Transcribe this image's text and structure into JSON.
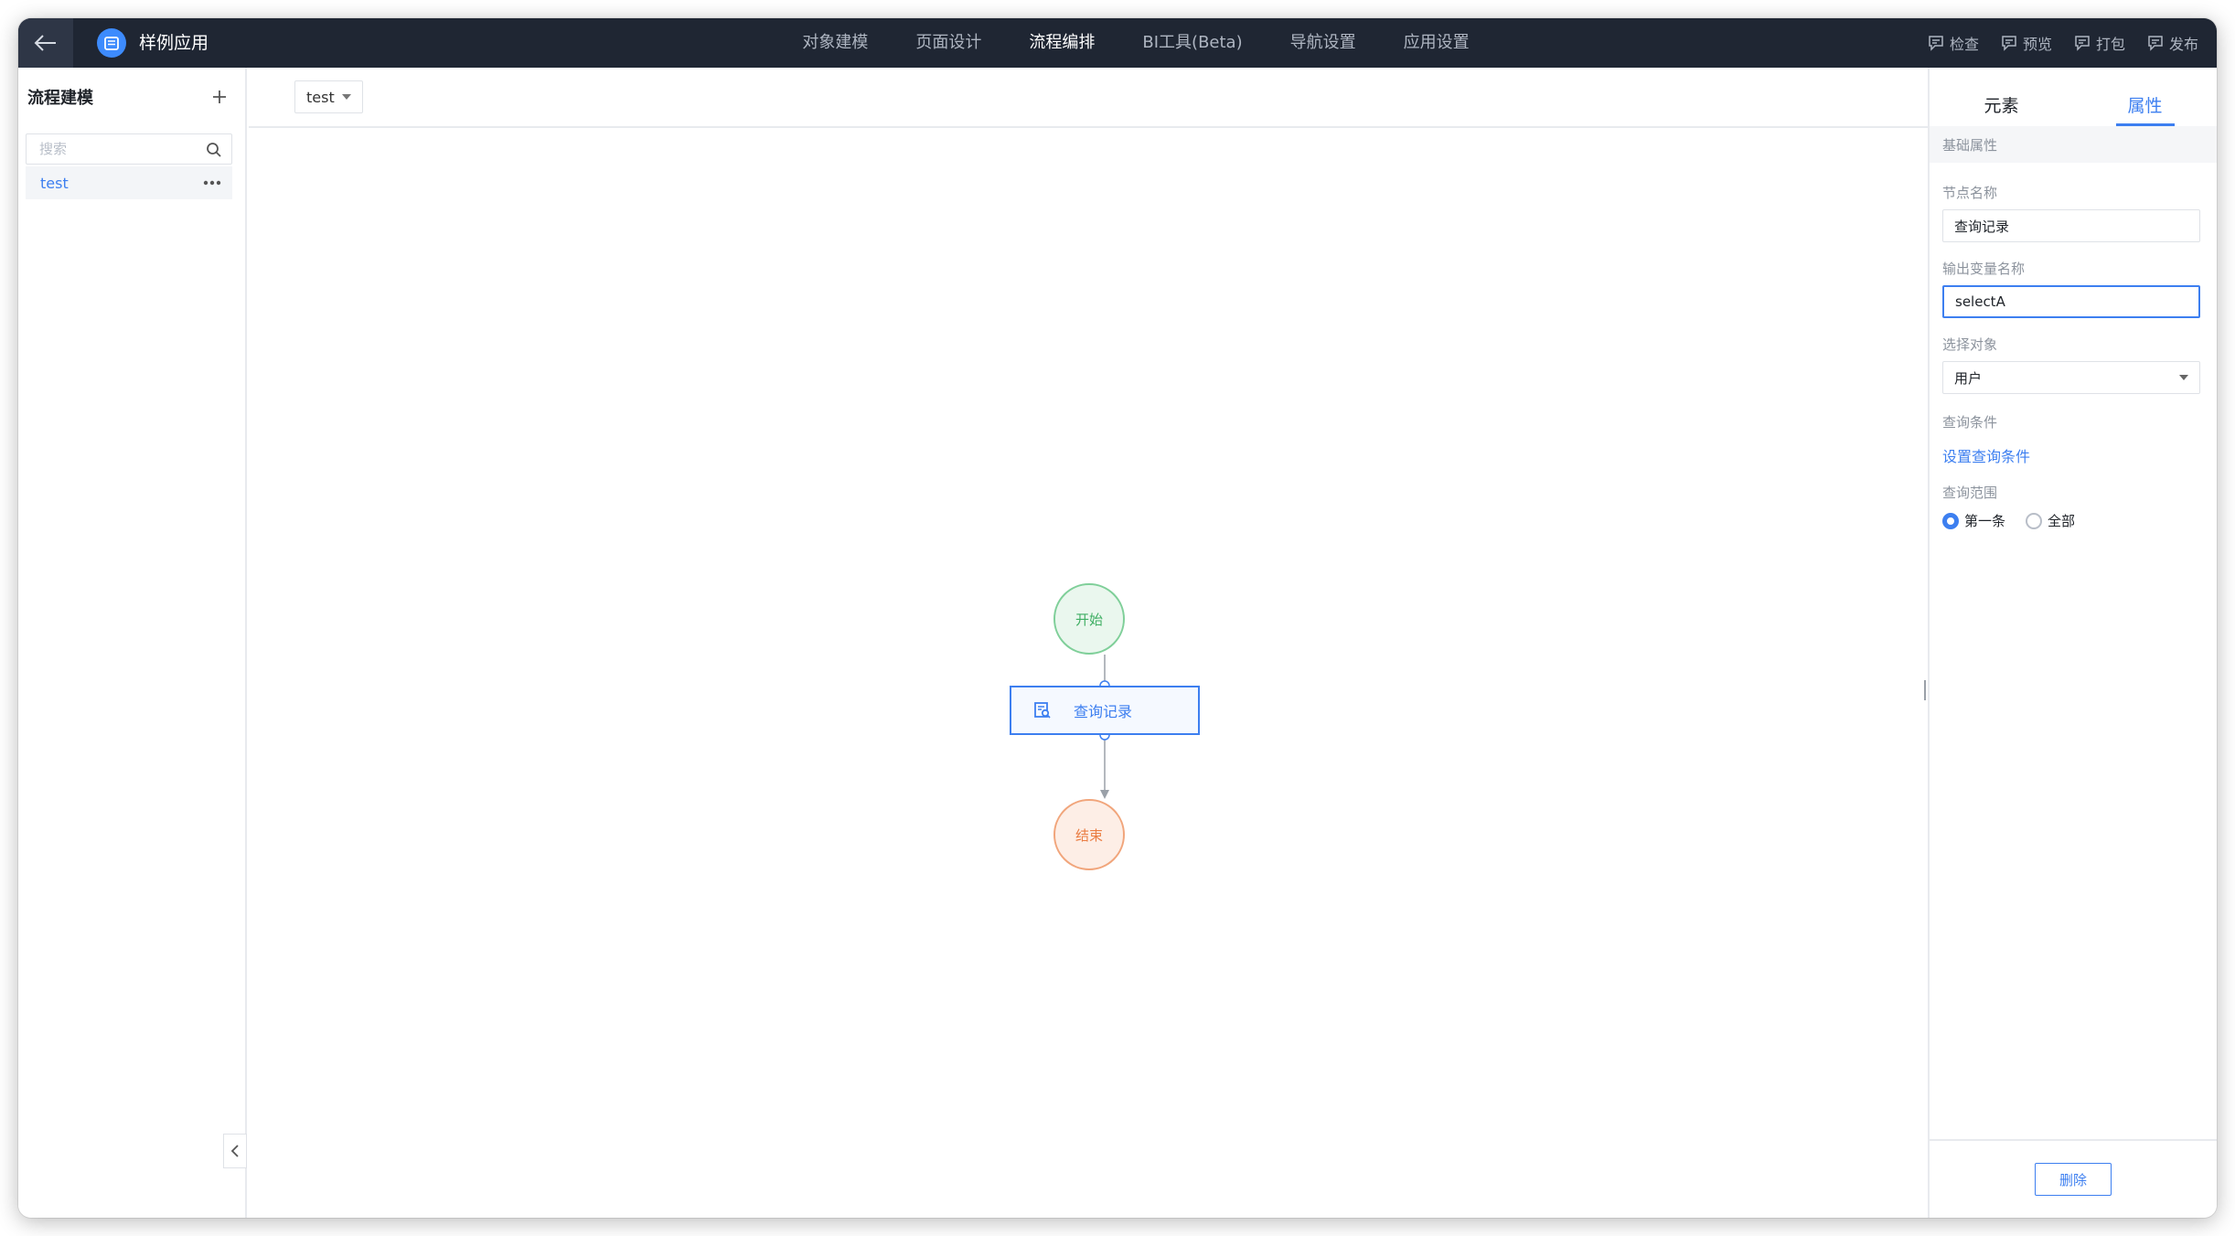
{
  "app": {
    "name": "样例应用"
  },
  "nav": {
    "items": [
      {
        "label": "对象建模"
      },
      {
        "label": "页面设计"
      },
      {
        "label": "流程编排"
      },
      {
        "label": "BI工具(Beta)"
      },
      {
        "label": "导航设置"
      },
      {
        "label": "应用设置"
      }
    ],
    "active_label": "流程编排"
  },
  "actions": [
    {
      "label": "检查",
      "icon": "doc-check-icon"
    },
    {
      "label": "预览",
      "icon": "doc-preview-icon"
    },
    {
      "label": "打包",
      "icon": "doc-package-icon"
    },
    {
      "label": "发布",
      "icon": "doc-publish-icon"
    }
  ],
  "sidebar": {
    "title": "流程建模",
    "search_placeholder": "搜索",
    "items": [
      {
        "label": "test"
      }
    ]
  },
  "toolbar": {
    "selected_flow": "test"
  },
  "canvas": {
    "start_label": "开始",
    "task_label": "查询记录",
    "end_label": "结束"
  },
  "panel": {
    "tabs": [
      {
        "label": "元素"
      },
      {
        "label": "属性"
      }
    ],
    "active_tab": "属性",
    "section_title": "基础属性",
    "node_name_label": "节点名称",
    "node_name_value": "查询记录",
    "output_var_label": "输出变量名称",
    "output_var_value": "selectA",
    "object_label": "选择对象",
    "object_value": "用户",
    "condition_label": "查询条件",
    "condition_link": "设置查询条件",
    "scope_label": "查询范围",
    "scope_options": [
      {
        "label": "第一条",
        "checked": true
      },
      {
        "label": "全部",
        "checked": false
      }
    ],
    "delete_label": "删除"
  },
  "colors": {
    "accent": "#3d7ff0",
    "topbar": "#1f2633",
    "start": "#3fae63",
    "end": "#ea7d43"
  }
}
